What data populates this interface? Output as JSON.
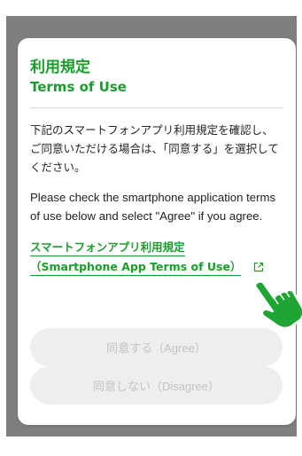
{
  "dialog": {
    "title_ja": "利用規定",
    "title_en": "Terms of Use",
    "body_ja": "下記のスマートフォンアプリ利用規定を確認し、ご同意いただける場合は、「同意する」を選択してください。",
    "body_en": "Please check the smartphone application terms of use below and select \"Agree\" if you agree.",
    "link_ja": "スマートフォンアプリ利用規定",
    "link_en": "（Smartphone App Terms of Use）",
    "agree_label": "同意する（Agree）",
    "disagree_label": "同意しない（Disagree）"
  },
  "colors": {
    "accent": "#1a9d2d",
    "backdrop": "#7f7f7f",
    "disabled_bg": "#eeeeee",
    "disabled_text": "#c3c3c3"
  },
  "icons": {
    "external": "external-link-icon",
    "pointer": "hand-pointer-icon"
  }
}
